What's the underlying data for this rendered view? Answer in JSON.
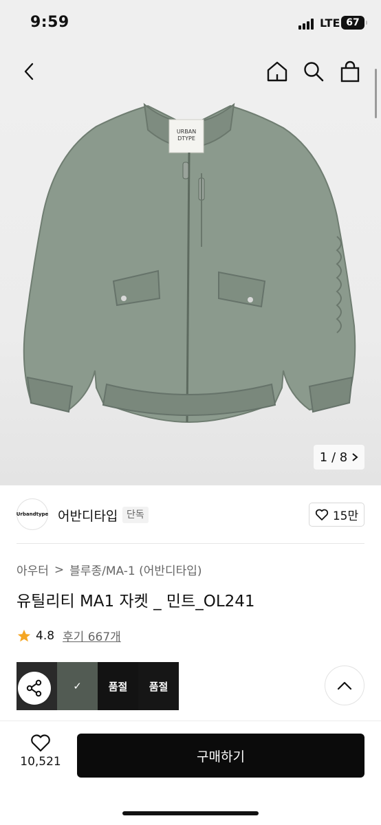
{
  "status_bar": {
    "time": "9:59",
    "network": "LTE",
    "battery": "67"
  },
  "nav": {
    "back_icon": "chevron-left-icon",
    "home_icon": "home-icon",
    "search_icon": "search-icon",
    "cart_icon": "shopping-bag-icon"
  },
  "gallery": {
    "page_indicator": "1 / 8",
    "label_text": "URBAN DTYPE",
    "jacket_color": "#8a9a8c"
  },
  "brand": {
    "logo_text": "Urbandtype",
    "name": "어반디타입",
    "badge": "단독",
    "likes": "15만"
  },
  "breadcrumb": {
    "level1": "아우터",
    "separator": ">",
    "level2": "블루종/MA-1 (어반디타입)"
  },
  "product": {
    "title": "유틸리티 MA1 자켓 _ 민트_OL241",
    "rating": "4.8",
    "reviews": "후기 667개"
  },
  "options": {
    "swatches": [
      {
        "name": "person",
        "label": "",
        "color": "#2a2a2a"
      },
      {
        "name": "mint",
        "label": "✓",
        "color": "#7f8d80"
      },
      {
        "name": "black",
        "label": "품절",
        "color": "#1e1e1e"
      },
      {
        "name": "black2",
        "label": "품절",
        "color": "#222222"
      }
    ]
  },
  "bottom_bar": {
    "wish_count": "10,521",
    "buy_label": "구매하기"
  }
}
